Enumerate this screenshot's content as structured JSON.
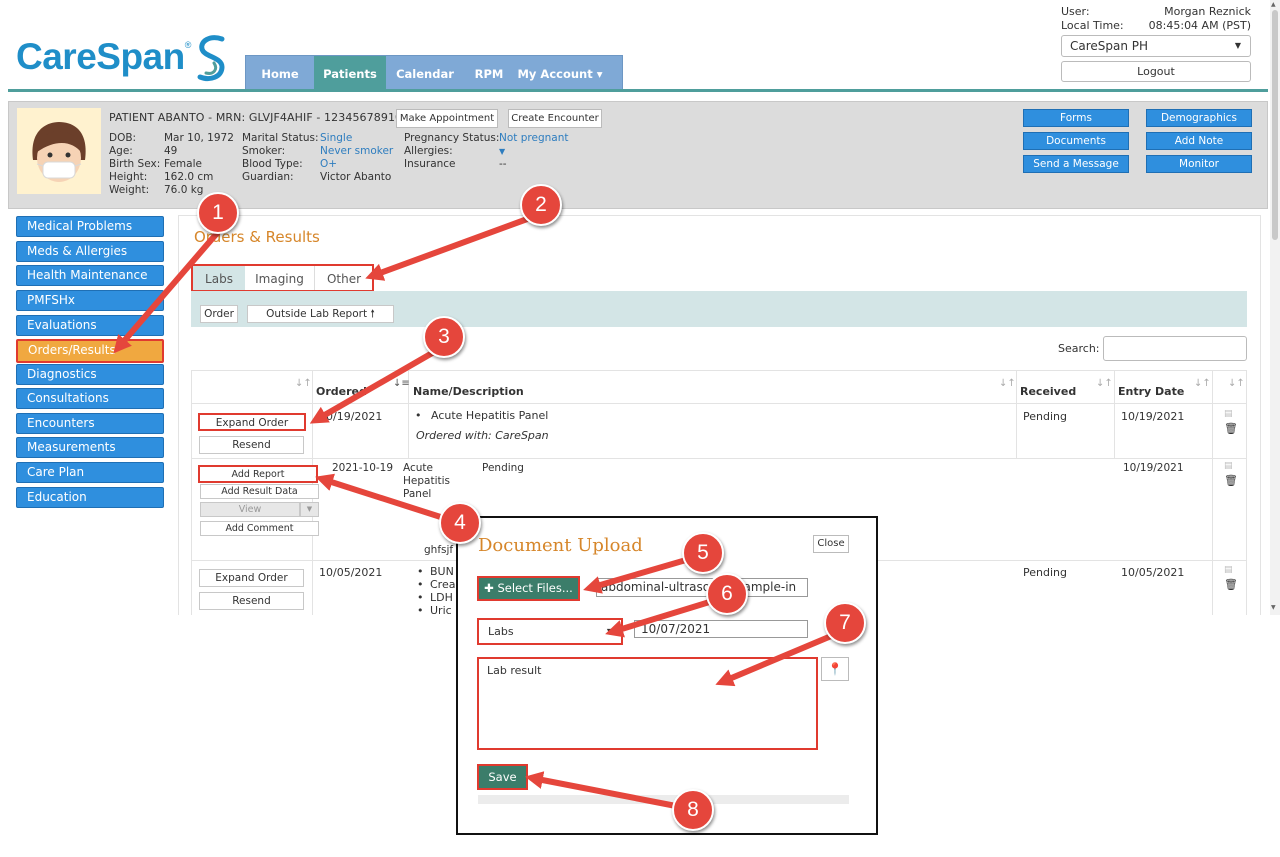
{
  "brand": {
    "name": "CareSpan",
    "trademark": "®"
  },
  "nav": {
    "items": [
      "Home",
      "Patients",
      "Calendar",
      "RPM",
      "My Account ▾"
    ],
    "active": "Patients"
  },
  "user": {
    "user_label": "User:",
    "user_name": "Morgan Reznick",
    "time_label": "Local Time:",
    "time_value": "08:45:04 AM (PST)",
    "clinic": "CareSpan PH",
    "logout": "Logout"
  },
  "patient": {
    "header": "PATIENT ABANTO - MRN: GLVJF4AHIF - 12345678910",
    "make_appointment": "Make Appointment",
    "create_encounter": "Create Encounter",
    "col1_labels": [
      "DOB:",
      "Age:",
      "Birth Sex:",
      "Height:",
      "Weight:"
    ],
    "col1_values": [
      "Mar 10, 1972",
      "49",
      "Female",
      "162.0 cm",
      "76.0 kg"
    ],
    "col2_labels": [
      "Marital Status:",
      "Smoker:",
      "Blood Type:",
      "Guardian:"
    ],
    "col2_values": [
      "Single",
      "Never smoker",
      "O+",
      "Victor Abanto"
    ],
    "col3_labels": [
      "Pregnancy Status:",
      "Allergies:",
      "Insurance"
    ],
    "col3_values": [
      "Not pregnant",
      "▼",
      "--"
    ]
  },
  "actions": [
    "Forms",
    "Demographics",
    "Documents",
    "Add Note",
    "Send a Message",
    "Monitor"
  ],
  "sidebar": {
    "items": [
      "Medical Problems",
      "Meds & Allergies",
      "Health Maintenance",
      "PMFSHx",
      "Evaluations",
      "Orders/Results",
      "Diagnostics",
      "Consultations",
      "Encounters",
      "Measurements",
      "Care Plan",
      "Education"
    ],
    "active": "Orders/Results"
  },
  "section": {
    "title": "Orders & Results",
    "tabs": [
      "Labs",
      "Imaging",
      "Other"
    ],
    "order_btn": "Order",
    "outside_lab_btn": "Outside Lab Report 🠕",
    "search_label": "Search:"
  },
  "table": {
    "headers": [
      "Ordered",
      "Name/Description",
      "Received",
      "Entry Date"
    ],
    "row1": {
      "expand": "Expand Order",
      "resend": "Resend",
      "ordered": "10/19/2021",
      "name": "Acute Hepatitis Panel",
      "ordered_with": "Ordered with: CareSpan",
      "received": "Pending",
      "entry_date": "10/19/2021"
    },
    "subrow": {
      "add_report": "Add Report",
      "add_result": "Add Result Data",
      "view": "View",
      "add_comment": "Add Comment",
      "date": "2021-10-19",
      "name_lines": [
        "Acute",
        "Hepatitis",
        "Panel"
      ],
      "status": "Pending",
      "entry_date": "10/19/2021",
      "extra": "ghfsjf"
    },
    "row2": {
      "expand": "Expand Order",
      "resend": "Resend",
      "ordered": "10/05/2021",
      "items": [
        "BUN",
        "Crea",
        "LDH",
        "Uric"
      ],
      "received": "Pending",
      "entry_date": "10/05/2021"
    }
  },
  "modal": {
    "title": "Document Upload",
    "close": "Close",
    "select_files": "✚ Select Files...",
    "file_name": "abdominal-ultrasound-sample-in",
    "doc_type": "Labs",
    "date": "10/07/2021",
    "note": "Lab result",
    "save": "Save"
  },
  "callouts": [
    "1",
    "2",
    "3",
    "4",
    "5",
    "6",
    "7",
    "8"
  ],
  "colors": {
    "brand_blue": "#1f8ec8",
    "nav_bg": "#7fa9d6",
    "nav_active": "#4f9e9c",
    "button_blue": "#2f8fde",
    "annotation_red": "#e03a2f",
    "title_orange": "#d6862a",
    "save_green": "#3b7d6a"
  }
}
